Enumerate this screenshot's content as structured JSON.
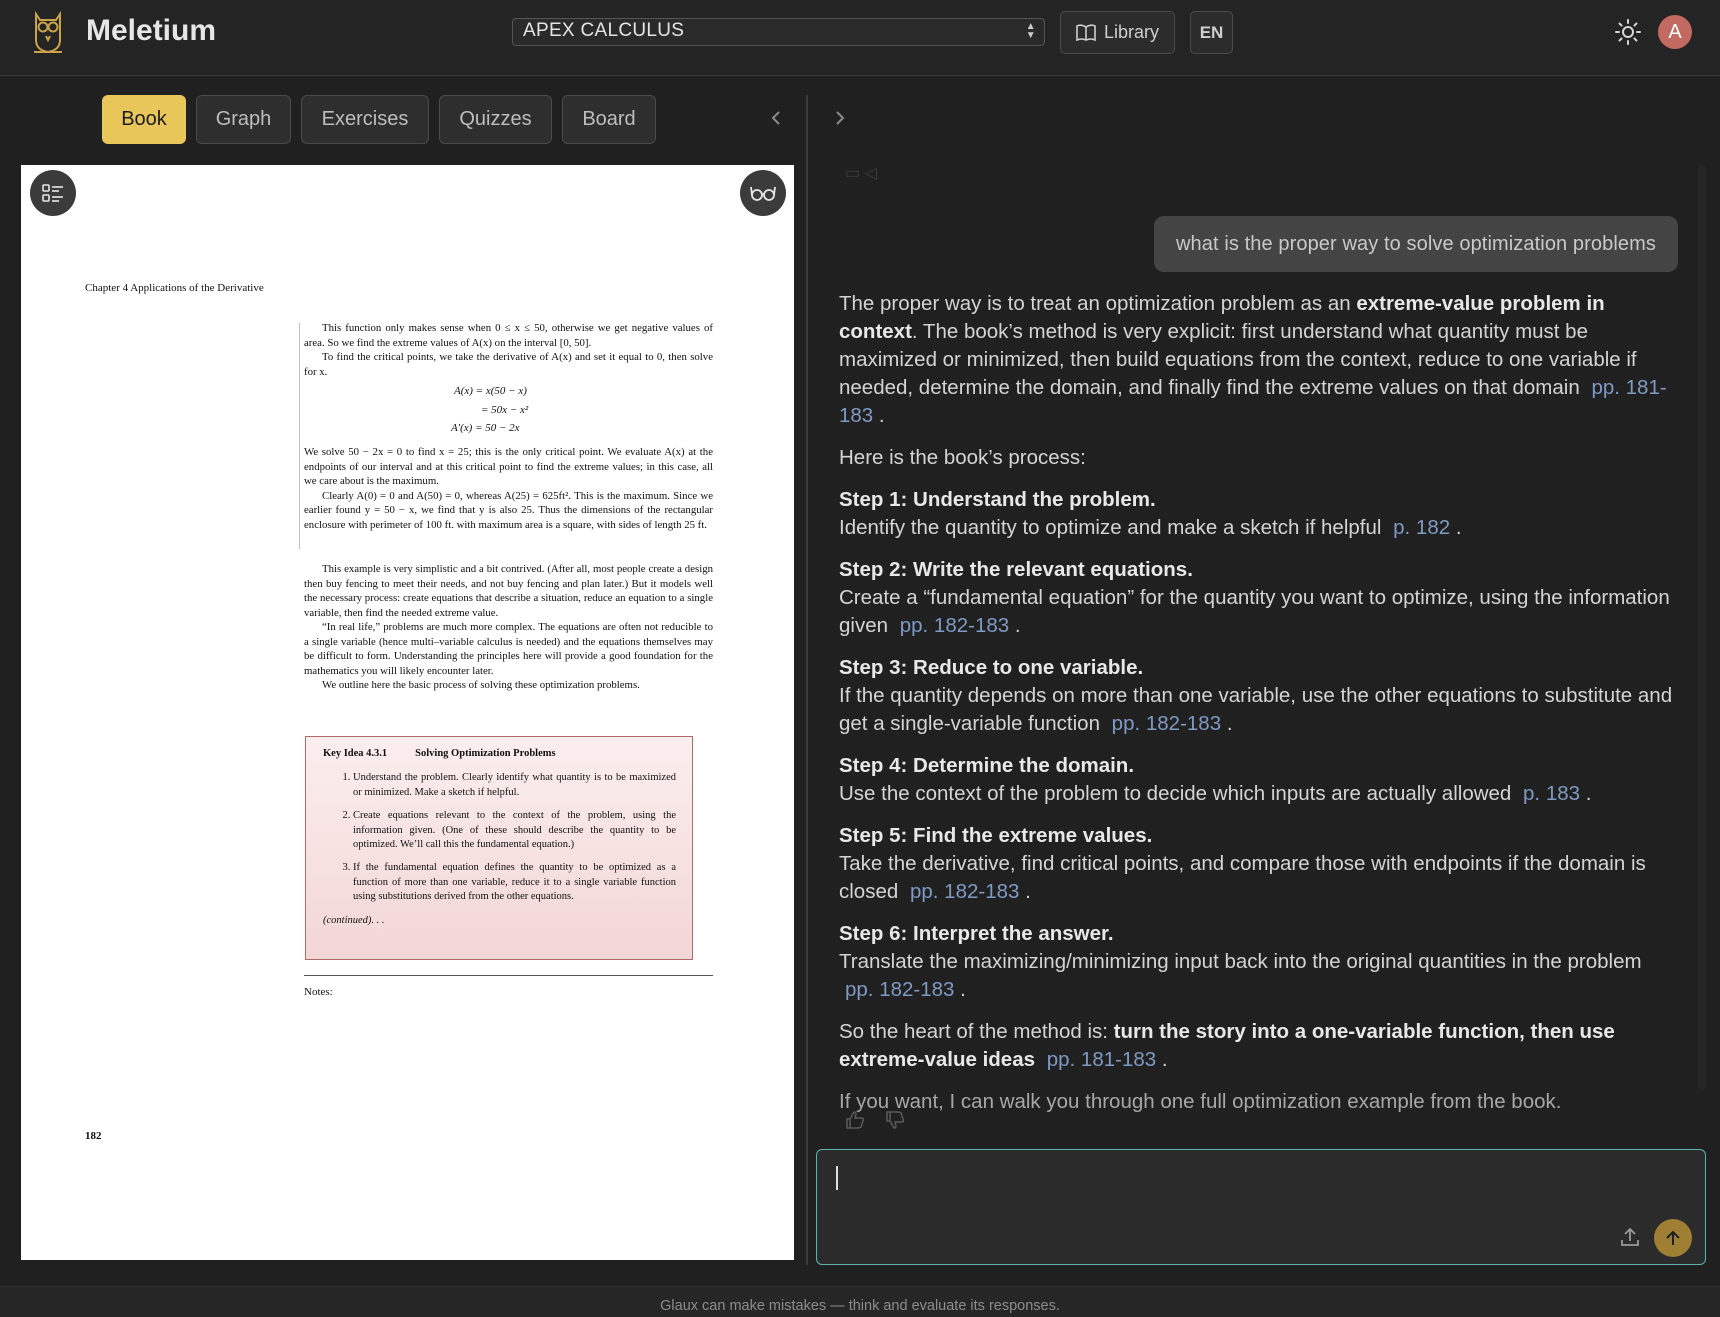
{
  "header": {
    "app_name": "Meletium",
    "book_select": "APEX CALCULUS",
    "library_label": "Library",
    "language": "EN",
    "avatar_initial": "A"
  },
  "tabs": [
    {
      "label": "Book",
      "active": true
    },
    {
      "label": "Graph",
      "active": false
    },
    {
      "label": "Exercises",
      "active": false
    },
    {
      "label": "Quizzes",
      "active": false
    },
    {
      "label": "Board",
      "active": false
    }
  ],
  "book_page": {
    "chapter_header": "Chapter 4   Applications of the Derivative",
    "para1": "This function only makes sense when 0 ≤ x ≤ 50, otherwise we get negative values of area. So we find the extreme values of A(x) on the interval [0, 50].",
    "para2": "To find the critical points, we take the derivative of A(x) and set it equal to 0, then solve for x.",
    "math1": "A(x) = x(50 − x)",
    "math2": "= 50x − x²",
    "math3": "A′(x) = 50 − 2x",
    "para3": "We solve 50 − 2x = 0 to find x = 25; this is the only critical point. We evaluate A(x) at the endpoints of our interval and at this critical point to find the extreme values; in this case, all we care about is the maximum.",
    "para4": "Clearly A(0) = 0 and A(50) = 0, whereas A(25) = 625ft². This is the maximum. Since we earlier found y = 50 − x, we find that y is also 25. Thus the dimensions of the rectangular enclosure with perimeter of 100 ft. with maximum area is a square, with sides of length 25 ft.",
    "para5": "This example is very simplistic and a bit contrived. (After all, most people create a design then buy fencing to meet their needs, and not buy fencing and plan later.) But it models well the necessary process: create equations that describe a situation, reduce an equation to a single variable, then find the needed extreme value.",
    "para6": "“In real life,” problems are much more complex. The equations are often not reducible to a single variable (hence multi–variable calculus is needed) and the equations themselves may be difficult to form. Understanding the principles here will provide a good foundation for the mathematics you will likely encounter later.",
    "para7": "We outline here the basic process of solving these optimization problems.",
    "key_idea_number": "Key Idea 4.3.1",
    "key_idea_title": "Solving Optimization Problems",
    "key_items": [
      "Understand the problem. Clearly identify what quantity is to be maximized or minimized. Make a sketch if helpful.",
      "Create equations relevant to the context of the problem, using the information given. (One of these should describe the quantity to be optimized. We’ll call this the fundamental equation.)",
      "If the fundamental equation defines the quantity to be optimized as a function of more than one variable, reduce it to a single variable function using substitutions derived from the other equations."
    ],
    "continued": "(continued). . .",
    "notes_label": "Notes:",
    "page_number": "182"
  },
  "chat": {
    "user_message": "what is the proper way to solve optimization problems",
    "intro_pre": "The proper way is to treat an optimization problem as an ",
    "intro_bold": "extreme-value problem in context",
    "intro_post": ". The book’s method is very explicit: first understand what quantity must be maximized or minimized, then build equations from the context, reduce to one variable if needed, determine the domain, and finally find the extreme values on that domain",
    "intro_ref": "pp. 181-183",
    "process_line": "Here is the book’s process:",
    "steps": [
      {
        "title": "Step 1: Understand the problem.",
        "text": "Identify the quantity to optimize and make a sketch if helpful",
        "ref": "p. 182"
      },
      {
        "title": "Step 2: Write the relevant equations.",
        "text": "Create a “fundamental equation” for the quantity you want to optimize, using the information given",
        "ref": "pp. 182-183"
      },
      {
        "title": "Step 3: Reduce to one variable.",
        "text": "If the quantity depends on more than one variable, use the other equations to substitute and get a single-variable function",
        "ref": "pp. 182-183"
      },
      {
        "title": "Step 4: Determine the domain.",
        "text": "Use the context of the problem to decide which inputs are actually allowed",
        "ref": "p. 183"
      },
      {
        "title": "Step 5: Find the extreme values.",
        "text": "Take the derivative, find critical points, and compare those with endpoints if the domain is closed",
        "ref": "pp. 182-183"
      },
      {
        "title": "Step 6: Interpret the answer.",
        "text": "Translate the maximizing/minimizing input back into the original quantities in the problem",
        "ref": "pp. 182-183"
      }
    ],
    "summary_pre": "So the heart of the method is: ",
    "summary_bold": "turn the story into a one-variable function, then use extreme-value ideas",
    "summary_ref": "pp. 181-183",
    "offer": "If you want, I can walk you through one full optimization example from the book.",
    "period": "."
  },
  "composer": {
    "placeholder": ""
  },
  "footer": {
    "disclaimer": "Glaux can make mistakes — think and evaluate its responses."
  },
  "colors": {
    "accent": "#e8c65a",
    "link": "#7f9ac4",
    "composer_border": "#5bb3aa",
    "send": "#9e7f33"
  },
  "icons": [
    "owl-logo-icon",
    "book-open-icon",
    "sun-icon",
    "list-icon",
    "glasses-icon",
    "chevron-left-icon",
    "chevron-right-icon",
    "thumbs-up-icon",
    "thumbs-down-icon",
    "upload-icon",
    "arrow-up-icon"
  ]
}
